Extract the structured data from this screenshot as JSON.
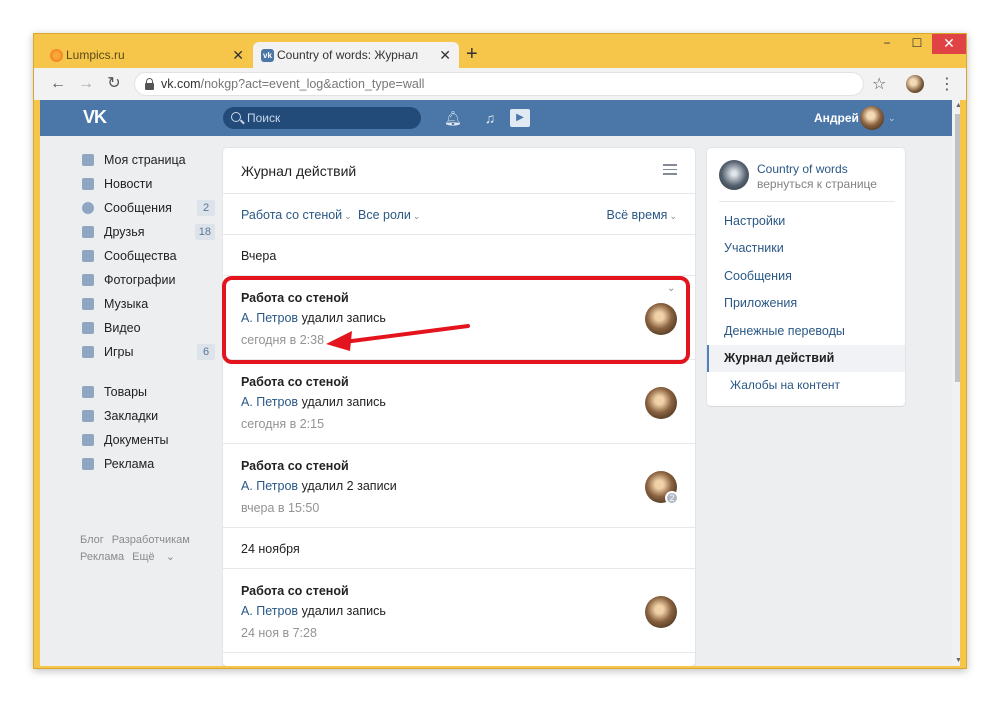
{
  "browser": {
    "tabs": [
      {
        "label": "Lumpics.ru",
        "active": false
      },
      {
        "label": "Country of words: Журнал дейст",
        "active": true
      }
    ],
    "url_host": "vk.com",
    "url_path": "/nokgp?act=event_log&action_type=wall",
    "buttons": {
      "minimize": "−",
      "maximize": "☐",
      "close": "✕",
      "new_tab": "+",
      "close_tab": "✕"
    }
  },
  "vk_header": {
    "logo": "VK",
    "search_placeholder": "Поиск",
    "user_name": "Андрей",
    "accent_color": "#4a76a8"
  },
  "sidebar": {
    "items": [
      {
        "label": "Моя страница",
        "icon": "home-icon",
        "badge": ""
      },
      {
        "label": "Новости",
        "icon": "news-icon",
        "badge": ""
      },
      {
        "label": "Сообщения",
        "icon": "messages-icon",
        "badge": "2"
      },
      {
        "label": "Друзья",
        "icon": "friends-icon",
        "badge": "18"
      },
      {
        "label": "Сообщества",
        "icon": "communities-icon",
        "badge": ""
      },
      {
        "label": "Фотографии",
        "icon": "camera-icon",
        "badge": ""
      },
      {
        "label": "Музыка",
        "icon": "music-icon",
        "badge": ""
      },
      {
        "label": "Видео",
        "icon": "video-icon",
        "badge": ""
      },
      {
        "label": "Игры",
        "icon": "gamepad-icon",
        "badge": "6"
      }
    ],
    "items2": [
      {
        "label": "Товары",
        "icon": "bag-icon"
      },
      {
        "label": "Закладки",
        "icon": "star-icon"
      },
      {
        "label": "Документы",
        "icon": "document-icon"
      },
      {
        "label": "Реклама",
        "icon": "megaphone-icon"
      }
    ],
    "footer": {
      "blog": "Блог",
      "dev": "Разработчикам",
      "ads": "Реклама",
      "more": "Ещё"
    }
  },
  "main": {
    "title": "Журнал действий",
    "filters": {
      "type": "Работа со стеной",
      "roles": "Все роли",
      "time": "Всё время"
    },
    "sections": [
      {
        "date": "Вчера",
        "entries": [
          {
            "title": "Работа со стеной",
            "actor": "А. Петров",
            "action": "удалил запись",
            "time": "сегодня в 2:38",
            "count": ""
          },
          {
            "title": "Работа со стеной",
            "actor": "А. Петров",
            "action": "удалил запись",
            "time": "сегодня в 2:15",
            "count": ""
          },
          {
            "title": "Работа со стеной",
            "actor": "А. Петров",
            "action": "удалил 2 записи",
            "time": "вчера в 15:50",
            "count": "2"
          }
        ]
      },
      {
        "date": "24 ноября",
        "entries": [
          {
            "title": "Работа со стеной",
            "actor": "А. Петров",
            "action": "удалил запись",
            "time": "24 ноя в 7:28",
            "count": ""
          }
        ]
      }
    ],
    "annotation_color": "#e3141e"
  },
  "right": {
    "group_name": "Country of words",
    "group_back": "вернуться к странице",
    "menu": [
      {
        "label": "Настройки",
        "active": false
      },
      {
        "label": "Участники",
        "active": false
      },
      {
        "label": "Сообщения",
        "active": false
      },
      {
        "label": "Приложения",
        "active": false
      },
      {
        "label": "Денежные переводы",
        "active": false
      },
      {
        "label": "Журнал действий",
        "active": true
      },
      {
        "label": "Жалобы на контент",
        "active": false
      }
    ]
  }
}
